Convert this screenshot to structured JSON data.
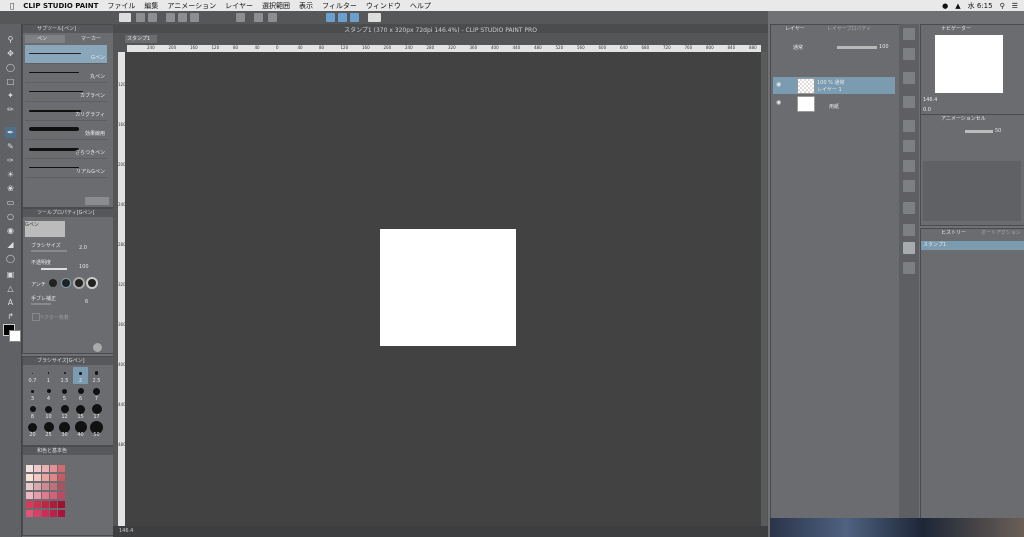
{
  "menubar": {
    "app": "CLIP STUDIO PAINT",
    "items": [
      "ファイル",
      "編集",
      "アニメーション",
      "レイヤー",
      "選択範囲",
      "表示",
      "フィルター",
      "ウィンドウ",
      "ヘルプ"
    ],
    "clock": "水 6:15"
  },
  "document": {
    "tab": "スタンプ1",
    "title": "スタンプ1 (370 x 320px 72dpi 146.4%) - CLIP STUDIO PAINT PRO",
    "zoom": "146.4",
    "ruler_h": [
      "240",
      "200",
      "160",
      "120",
      "80",
      "40",
      "0",
      "40",
      "80",
      "120",
      "160",
      "200",
      "240",
      "280",
      "320",
      "360",
      "400",
      "440",
      "480",
      "520",
      "560",
      "600",
      "640",
      "680",
      "720",
      "760",
      "800",
      "840",
      "880",
      "920",
      "960"
    ],
    "ruler_v": [
      "120",
      "160",
      "200",
      "240",
      "280",
      "320",
      "360",
      "400",
      "440",
      "480"
    ]
  },
  "subtool": {
    "title": "サブツール[ペン]",
    "tabs": [
      "ペン",
      "マーカー"
    ],
    "brushes": [
      "Gペン",
      "丸ペン",
      "カブラペン",
      "カリグラフィ",
      "効果線用",
      "ざらつきペン",
      "リアルGペン"
    ]
  },
  "toolprop": {
    "title": "ツールプロパティ[Gペン]",
    "brush_name": "Gペン",
    "brush_size_label": "ブラシサイズ",
    "brush_size": "2.0",
    "opacity_label": "不透明度",
    "opacity": "100",
    "aa_label": "アンチ",
    "stabilize_label": "手ブレ補正",
    "stabilize": "6",
    "vector_label": "ベクター吸着"
  },
  "brushsize": {
    "title": "ブラシサイズ[Gペン]",
    "sizes": [
      "0.7",
      "1",
      "1.5",
      "2",
      "2.5",
      "3",
      "4",
      "5",
      "6",
      "7",
      "8",
      "10",
      "12",
      "15",
      "17",
      "20",
      "25",
      "30",
      "40",
      "50"
    ]
  },
  "colorset": {
    "title": "和色と基本色"
  },
  "layers": {
    "tab": "レイヤー",
    "tab2": "レイヤープロパティ",
    "blend": "通常",
    "opacity": "100",
    "rows": [
      {
        "line1": "100 % 通常",
        "line2": "レイヤー 1"
      },
      {
        "line1": "",
        "line2": "用紙"
      }
    ]
  },
  "navigator": {
    "tab": "ナビゲーター",
    "zoom": "146.4",
    "angle": "0.0"
  },
  "animation": {
    "tab": "アニメーションセル",
    "value": "50"
  },
  "history": {
    "tab": "ヒストリー",
    "tab2": "オートアクション",
    "items": [
      "スタンプ1"
    ]
  },
  "colors": {
    "menubar_bg": "#e9e9ea",
    "panel_bg": "#6a6c6f",
    "workspace_bg": "#424242",
    "selected_row": "#7a9bb0"
  }
}
